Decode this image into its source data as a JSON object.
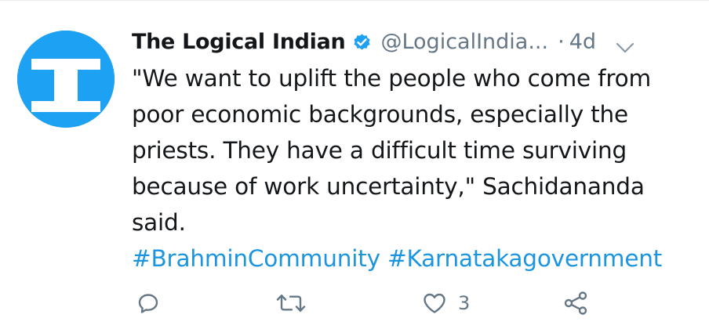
{
  "tweet": {
    "author_name": "The Logical Indian",
    "handle": "@LogicalIndia...",
    "separator": "·",
    "time": "4d",
    "text_lines": [
      "\"We want to uplift the people who come from",
      "poor economic backgrounds, especially the",
      "priests. They have a difficult time surviving",
      "because of work uncertainty,\" Sachidananda",
      "said."
    ],
    "hashtags": [
      "#BrahminCommunity",
      "#Karnatakagovernment"
    ],
    "like_count": "3"
  },
  "icons": {
    "avatar": "logical-indian-logo",
    "verified": "verified-badge-icon",
    "menu": "chevron-down-icon",
    "reply": "reply-icon",
    "retweet": "retweet-icon",
    "like": "heart-icon",
    "share": "share-icon"
  },
  "colors": {
    "brand_blue": "#1da1f2",
    "link_blue": "#1b95e0",
    "text": "#14171a",
    "muted": "#657786"
  }
}
